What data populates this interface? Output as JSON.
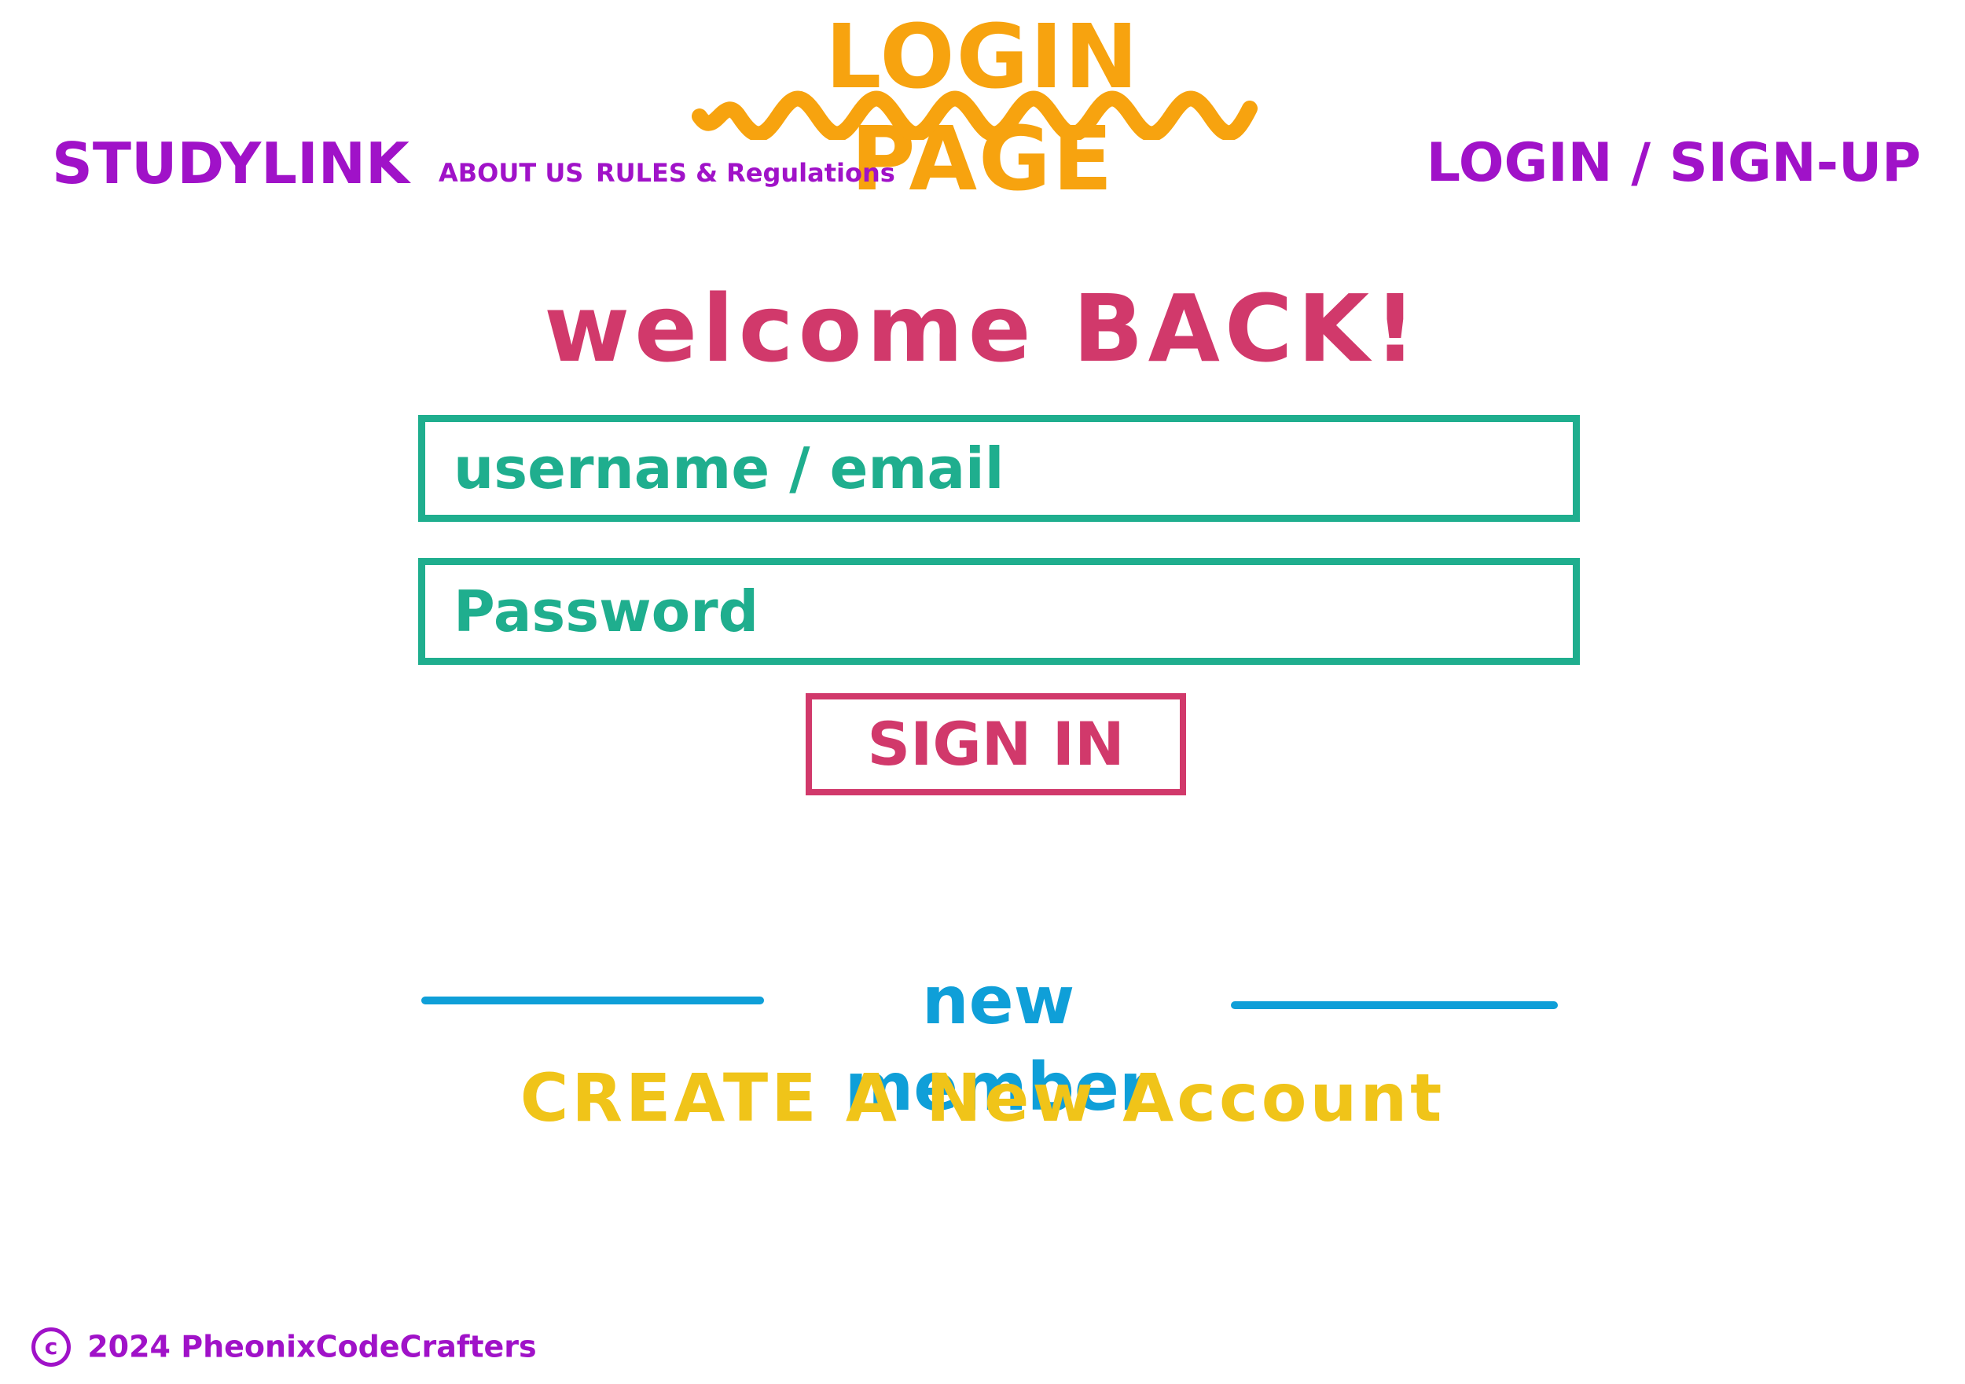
{
  "header": {
    "page_title": "LOGIN PAGE",
    "brand": "STUDYLINK",
    "nav": {
      "about": "ABOUT US",
      "rules": "RULES & Regulations"
    },
    "auth_link": "LOGIN / SIGN-UP"
  },
  "main": {
    "welcome": "welcome BACK!",
    "username_placeholder": "username / email",
    "password_placeholder": "Password",
    "signin_label": "SIGN IN",
    "new_member": "new member",
    "create_account": "CREATE A New Account"
  },
  "footer": {
    "copyright_symbol": "c",
    "text": "2024 PheonixCodeCrafters"
  },
  "colors": {
    "title": "#f7a30f",
    "brand": "#a012c8",
    "welcome": "#d1396b",
    "fields": "#1fae8e",
    "divider": "#0f9fd8",
    "create_account": "#f0c419"
  }
}
